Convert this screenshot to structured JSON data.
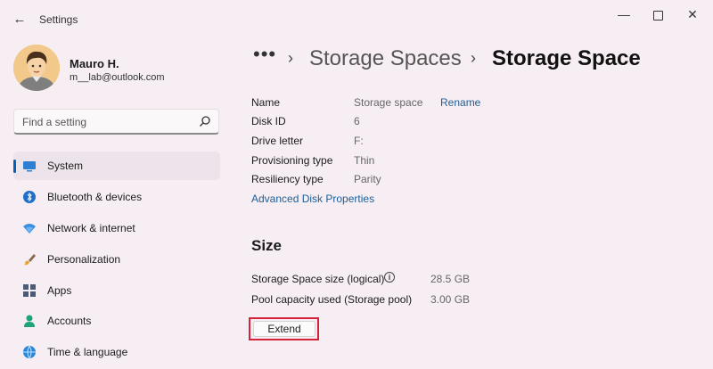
{
  "window": {
    "title": "Settings",
    "back_icon": "back-arrow-icon",
    "buttons": [
      "minimize-icon",
      "maximize-icon",
      "close-icon"
    ]
  },
  "user": {
    "name": "Mauro H.",
    "email": "m__lab@outlook.com"
  },
  "search": {
    "placeholder": "Find a setting",
    "icon": "search-icon"
  },
  "nav": {
    "items": [
      {
        "label": "System",
        "icon": "system-icon",
        "active": true
      },
      {
        "label": "Bluetooth & devices",
        "icon": "bluetooth-icon"
      },
      {
        "label": "Network & internet",
        "icon": "wifi-icon"
      },
      {
        "label": "Personalization",
        "icon": "brush-icon"
      },
      {
        "label": "Apps",
        "icon": "apps-icon"
      },
      {
        "label": "Accounts",
        "icon": "person-icon"
      },
      {
        "label": "Time & language",
        "icon": "globe-icon"
      }
    ]
  },
  "breadcrumb": {
    "overflow": "•••",
    "parent": "Storage Spaces",
    "current": "Storage Space"
  },
  "properties": {
    "name_label": "Name",
    "name_value": "Storage space",
    "rename_link": "Rename",
    "disk_id_label": "Disk ID",
    "disk_id_value": "6",
    "drive_letter_label": "Drive letter",
    "drive_letter_value": "F:",
    "provisioning_label": "Provisioning type",
    "provisioning_value": "Thin",
    "resiliency_label": "Resiliency type",
    "resiliency_value": "Parity",
    "advanced_link": "Advanced Disk Properties"
  },
  "size": {
    "title": "Size",
    "logical_label": "Storage Space size (logical)",
    "logical_value": "28.5 GB",
    "pool_label": "Pool capacity used (Storage pool)",
    "pool_value": "3.00 GB",
    "extend_button": "Extend"
  },
  "colors": {
    "accent": "#005fb8",
    "link": "#1d5d97",
    "highlight_outline": "#d6213a",
    "background": "#f6eef3"
  }
}
